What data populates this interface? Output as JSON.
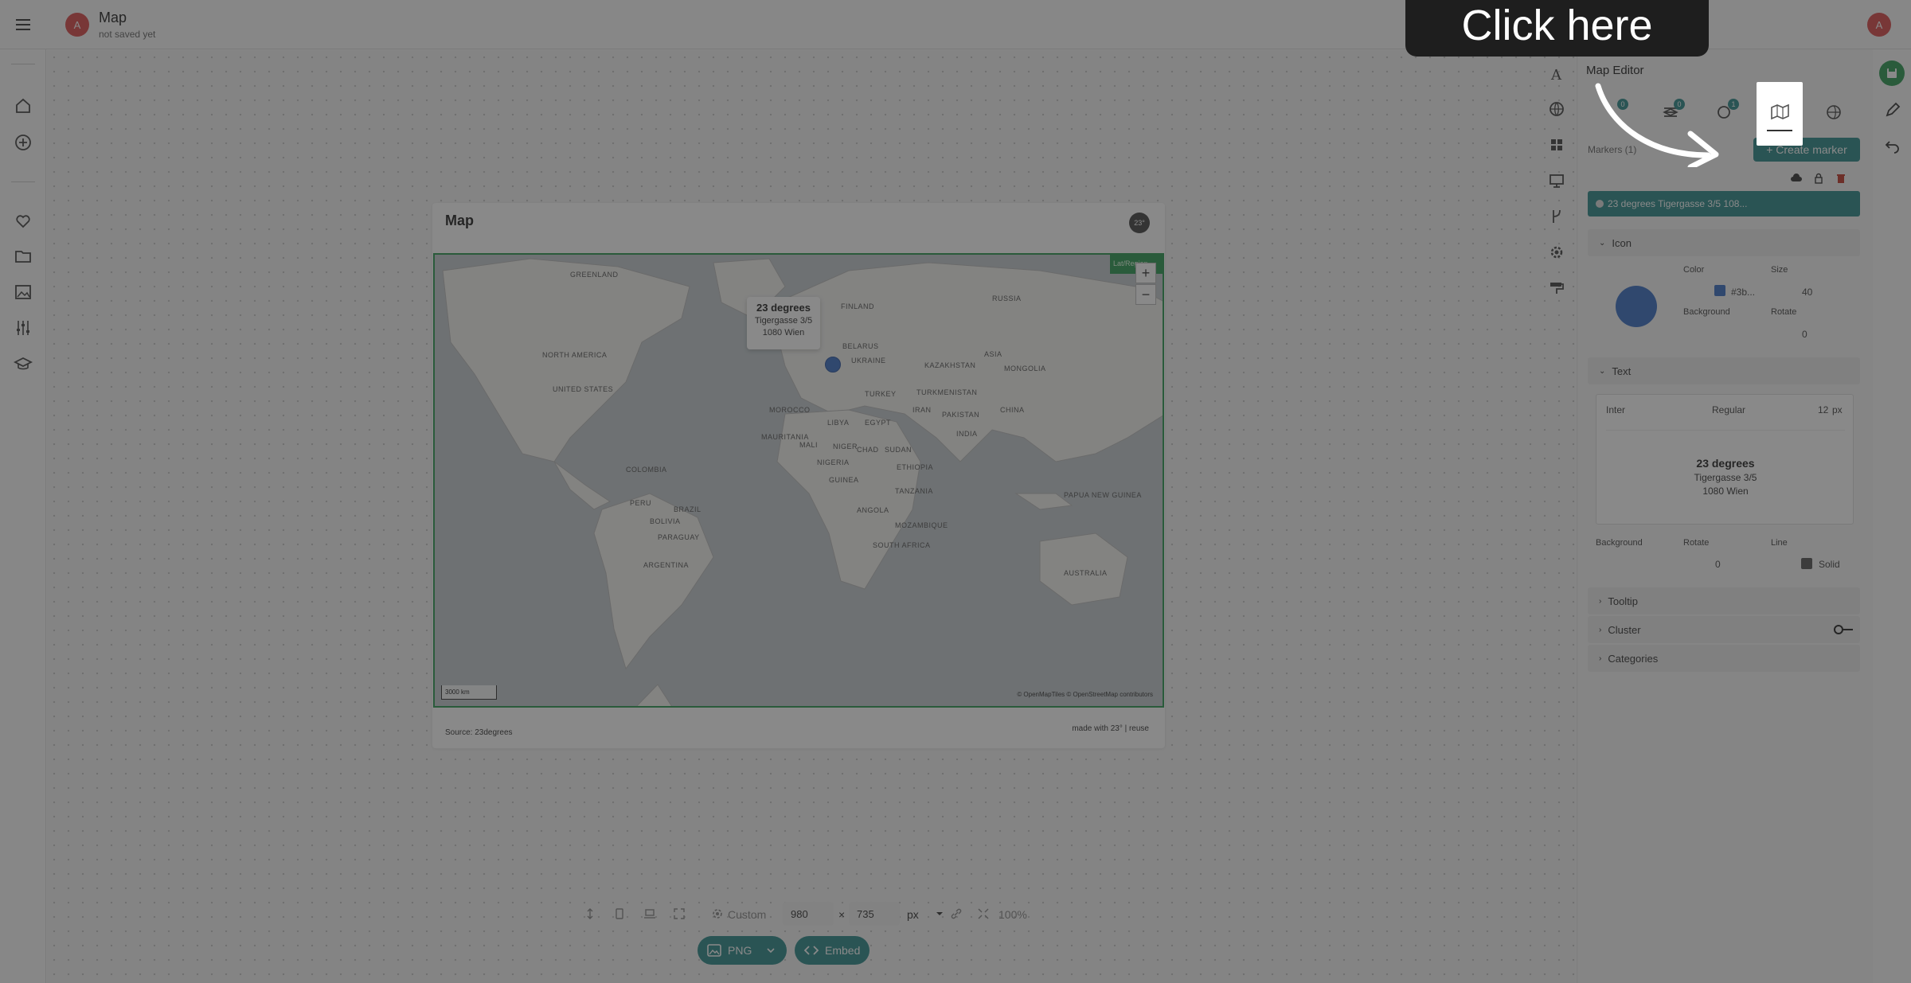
{
  "app": {
    "doc_title": "Map",
    "doc_status": "not saved yet",
    "avatar_initial": "A"
  },
  "card": {
    "title": "Map",
    "source": "Source: 23degrees",
    "made_with": "made with 23° | reuse",
    "logo_text": "23°"
  },
  "map": {
    "scale": "3000 km",
    "attribution": "© OpenMapTiles © OpenStreetMap contributors",
    "zoom_in": "+",
    "zoom_out": "−",
    "corner_tab": "Lat/Region",
    "labels": {
      "north_america": "NORTH AMERICA",
      "united_states": "UNITED STATES",
      "greenland": "GREENLAND",
      "finland": "FINLAND",
      "russia": "RUSSIA",
      "belarus": "BELARUS",
      "ukraine": "UKRAINE",
      "kazakhstan": "KAZAKHSTAN",
      "asia": "ASIA",
      "mongolia": "MONGOLIA",
      "turkey": "TURKEY",
      "turkmenistan": "TURKMENISTAN",
      "morocco": "MOROCCO",
      "libya": "LIBYA",
      "egypt": "EGYPT",
      "iran": "IRAN",
      "pakistan": "PAKISTAN",
      "china": "CHINA",
      "india": "INDIA",
      "mauritania": "MAURITANIA",
      "mali": "MALI",
      "niger": "NIGER",
      "chad": "CHAD",
      "sudan": "SUDAN",
      "nigeria": "NIGERIA",
      "ethiopia": "ETHIOPIA",
      "colombia": "COLOMBIA",
      "peru": "PERU",
      "brazil": "BRAZIL",
      "bolivia": "BOLIVIA",
      "paraguay": "PARAGUAY",
      "argentina": "ARGENTINA",
      "angola": "ANGOLA",
      "tanzania": "TANZANIA",
      "mozambique": "MOZAMBIQUE",
      "south_africa": "SOUTH AFRICA",
      "australia": "AUSTRALIA",
      "papua": "PAPUA NEW GUINEA",
      "guinea": "GUINEA"
    },
    "popup": {
      "line1": "23 degrees",
      "line2": "Tigergasse 3/5",
      "line3": "1080 Wien"
    }
  },
  "bottom_toolbar": {
    "preset": "Custom",
    "width": "980",
    "times": "×",
    "height": "735",
    "unit": "px",
    "zoom": "100%",
    "png_label": "PNG",
    "embed_label": "Embed"
  },
  "callout": {
    "text": "Click here"
  },
  "panel": {
    "title": "Map Editor",
    "badges": [
      "0",
      "0",
      "1"
    ],
    "markers_label": "Markers (1)",
    "create_marker": "+ Create marker",
    "marker_row_label": "23 degrees Tigergasse 3/5 108...",
    "icon_section": "Icon",
    "color_label": "Color",
    "color_value": "#3b...",
    "color_hex": "#3b6fc4",
    "size_label": "Size",
    "size_value": "40",
    "background_label": "Background",
    "rotate_label": "Rotate",
    "rotate_value": "0",
    "text_section": "Text",
    "font_family": "Inter",
    "font_weight": "Regular",
    "font_size": "12",
    "font_unit": "px",
    "text_line1": "23 degrees",
    "text_line2": "Tigergasse 3/5",
    "text_line3": "1080 Wien",
    "bg_label": "Background",
    "bg_rotate_label": "Rotate",
    "bg_rotate_value": "0",
    "line_label": "Line",
    "line_value": "Solid",
    "tooltip_section": "Tooltip",
    "cluster_section": "Cluster",
    "categories_section": "Categories"
  }
}
